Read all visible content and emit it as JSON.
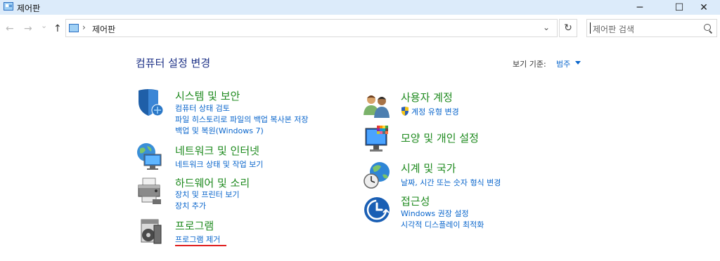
{
  "window": {
    "title": "제어판",
    "minimize_icon": "─",
    "maximize_icon": "☐",
    "close_icon": "✕"
  },
  "nav": {
    "back_icon": "←",
    "forward_icon": "→",
    "recent_icon": "⌄",
    "up_icon": "↑"
  },
  "address": {
    "separator": "›",
    "path": "제어판",
    "dropdown_icon": "⌄",
    "refresh_icon": "↻"
  },
  "search": {
    "placeholder": "제어판 검색"
  },
  "header": {
    "title": "컴퓨터 설정 변경",
    "view_by_label": "보기 기준:",
    "view_by_value": "범주"
  },
  "categories": {
    "system_security": {
      "title": "시스템 및 보안",
      "links": [
        "컴퓨터 상태 검토",
        "파일 히스토리로 파일의 백업 복사본 저장",
        "백업 및 복원(Windows 7)"
      ]
    },
    "network": {
      "title": "네트워크 및 인터넷",
      "links": [
        "네트워크 상태 및 작업 보기"
      ]
    },
    "hardware": {
      "title": "하드웨어 및 소리",
      "links": [
        "장치 및 프린터 보기",
        "장치 추가"
      ]
    },
    "programs": {
      "title": "프로그램",
      "links": [
        "프로그램 제거"
      ]
    },
    "user_accounts": {
      "title": "사용자 계정",
      "links": [
        "계정 유형 변경"
      ]
    },
    "appearance": {
      "title": "모양 및 개인 설정"
    },
    "clock_region": {
      "title": "시계 및 국가",
      "links": [
        "날짜, 시간 또는 숫자 형식 변경"
      ]
    },
    "ease_of_access": {
      "title": "접근성",
      "links": [
        "Windows 권장 설정",
        "시각적 디스플레이 최적화"
      ]
    }
  }
}
